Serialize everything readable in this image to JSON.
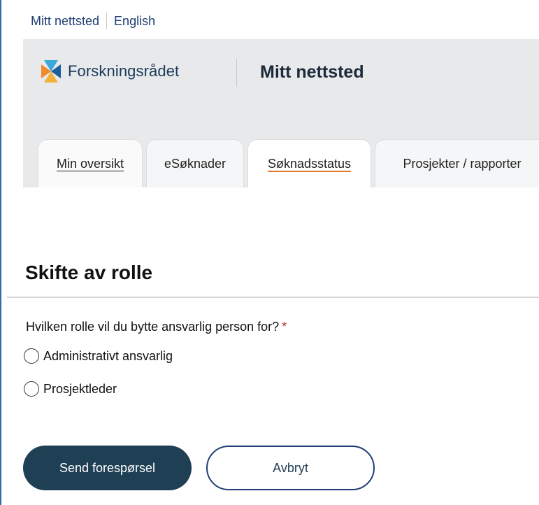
{
  "language_bar": {
    "current": "Mitt nettsted",
    "alternate": "English"
  },
  "header": {
    "brand": "Forskningsrådet",
    "site_title": "Mitt nettsted"
  },
  "tabs": [
    {
      "label": "Min oversikt"
    },
    {
      "label": "eSøknader"
    },
    {
      "label": "Søknadsstatus"
    },
    {
      "label": "Prosjekter / rapporter"
    }
  ],
  "form": {
    "heading": "Skifte av rolle",
    "question": "Hvilken rolle vil du bytte ansvarlig person for?",
    "required_mark": "*",
    "options": [
      {
        "label": "Administrativt ansvarlig",
        "selected": false
      },
      {
        "label": "Prosjektleder",
        "selected": false
      }
    ],
    "submit_label": "Send forespørsel",
    "cancel_label": "Avbryt"
  },
  "colors": {
    "primary": "#1f3f55",
    "header_bg": "#e7e9eb",
    "active_tab_underline": "#e4792c",
    "required": "#c0392b"
  },
  "icons": {
    "brand_logo": "forskningsradet-logo-icon"
  }
}
